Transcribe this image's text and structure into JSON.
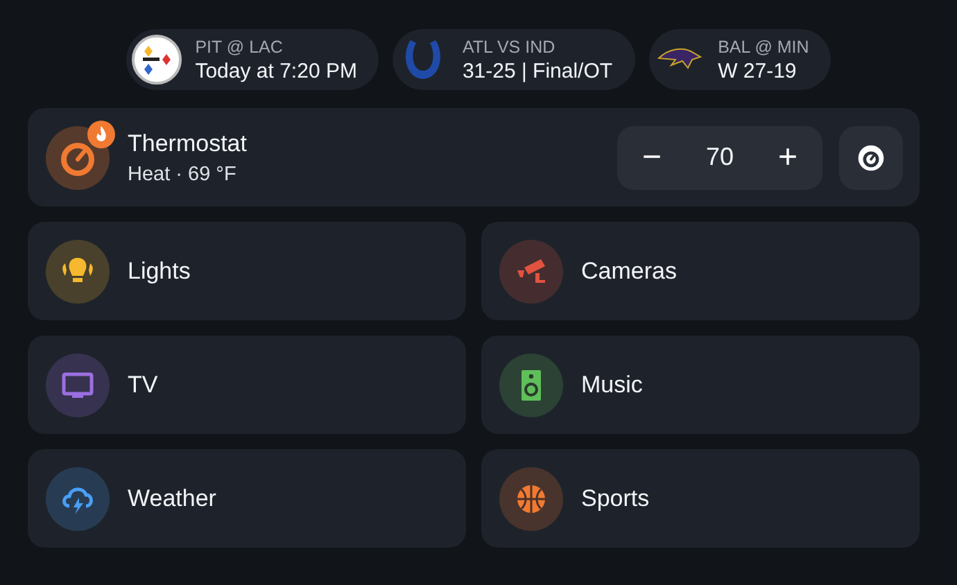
{
  "games": [
    {
      "kind": "badge",
      "matchup": "PIT @ LAC",
      "status": "Today at 7:20 PM"
    },
    {
      "kind": "horseshoe",
      "matchup": "ATL VS IND",
      "status": "31-25 | Final/OT"
    },
    {
      "kind": "bird",
      "matchup": "BAL @ MIN",
      "status": "W 27-19"
    }
  ],
  "thermostat": {
    "name": "Thermostat",
    "status": "Heat · 69 °F",
    "heating": true,
    "setpoint": "70",
    "minus": "−",
    "plus": "+"
  },
  "tiles": [
    {
      "kind": "lights",
      "label": "Lights",
      "color": "#f5b82e"
    },
    {
      "kind": "cameras",
      "label": "Cameras",
      "color": "#e2533f"
    },
    {
      "kind": "tv",
      "label": "TV",
      "color": "#9b6fe0"
    },
    {
      "kind": "music",
      "label": "Music",
      "color": "#5fbf5a"
    },
    {
      "kind": "weather",
      "label": "Weather",
      "color": "#4a9ff5"
    },
    {
      "kind": "sports",
      "label": "Sports",
      "color": "#f07a32"
    }
  ]
}
